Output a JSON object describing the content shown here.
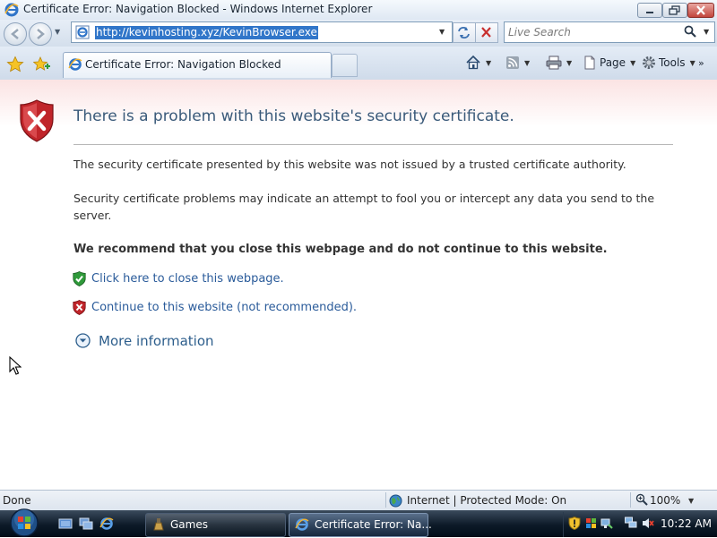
{
  "window": {
    "title": "Certificate Error: Navigation Blocked - Windows Internet Explorer"
  },
  "address_bar": {
    "url": "http://kevinhosting.xyz/KevinBrowser.exe"
  },
  "search": {
    "placeholder": "Live Search"
  },
  "tabs": [
    {
      "label": "Certificate Error: Navigation Blocked",
      "active": true
    }
  ],
  "command_bar": {
    "page_label": "Page",
    "tools_label": "Tools"
  },
  "error_page": {
    "headline": "There is a problem with this website's security certificate.",
    "paragraph1": "The security certificate presented by this website was not issued by a trusted certificate authority.",
    "paragraph2": "Security certificate problems may indicate an attempt to fool you or intercept any data you send to the server.",
    "recommendation": "We recommend that you close this webpage and do not continue to this website.",
    "close_link": "Click here to close this webpage.",
    "continue_link": "Continue to this website (not recommended).",
    "more_info": "More information"
  },
  "status_bar": {
    "status": "Done",
    "zone": "Internet | Protected Mode: On",
    "zoom": "100%"
  },
  "taskbar": {
    "buttons": [
      {
        "label": "Games",
        "active": false
      },
      {
        "label": "Certificate Error: Na...",
        "active": true
      }
    ],
    "clock": "10:22 AM"
  },
  "colors": {
    "link": "#2a5b9a",
    "headline": "#3a5a7a",
    "shield_red": "#c0252a",
    "shield_green": "#2f9a3a",
    "url_highlight": "#3176c9"
  }
}
